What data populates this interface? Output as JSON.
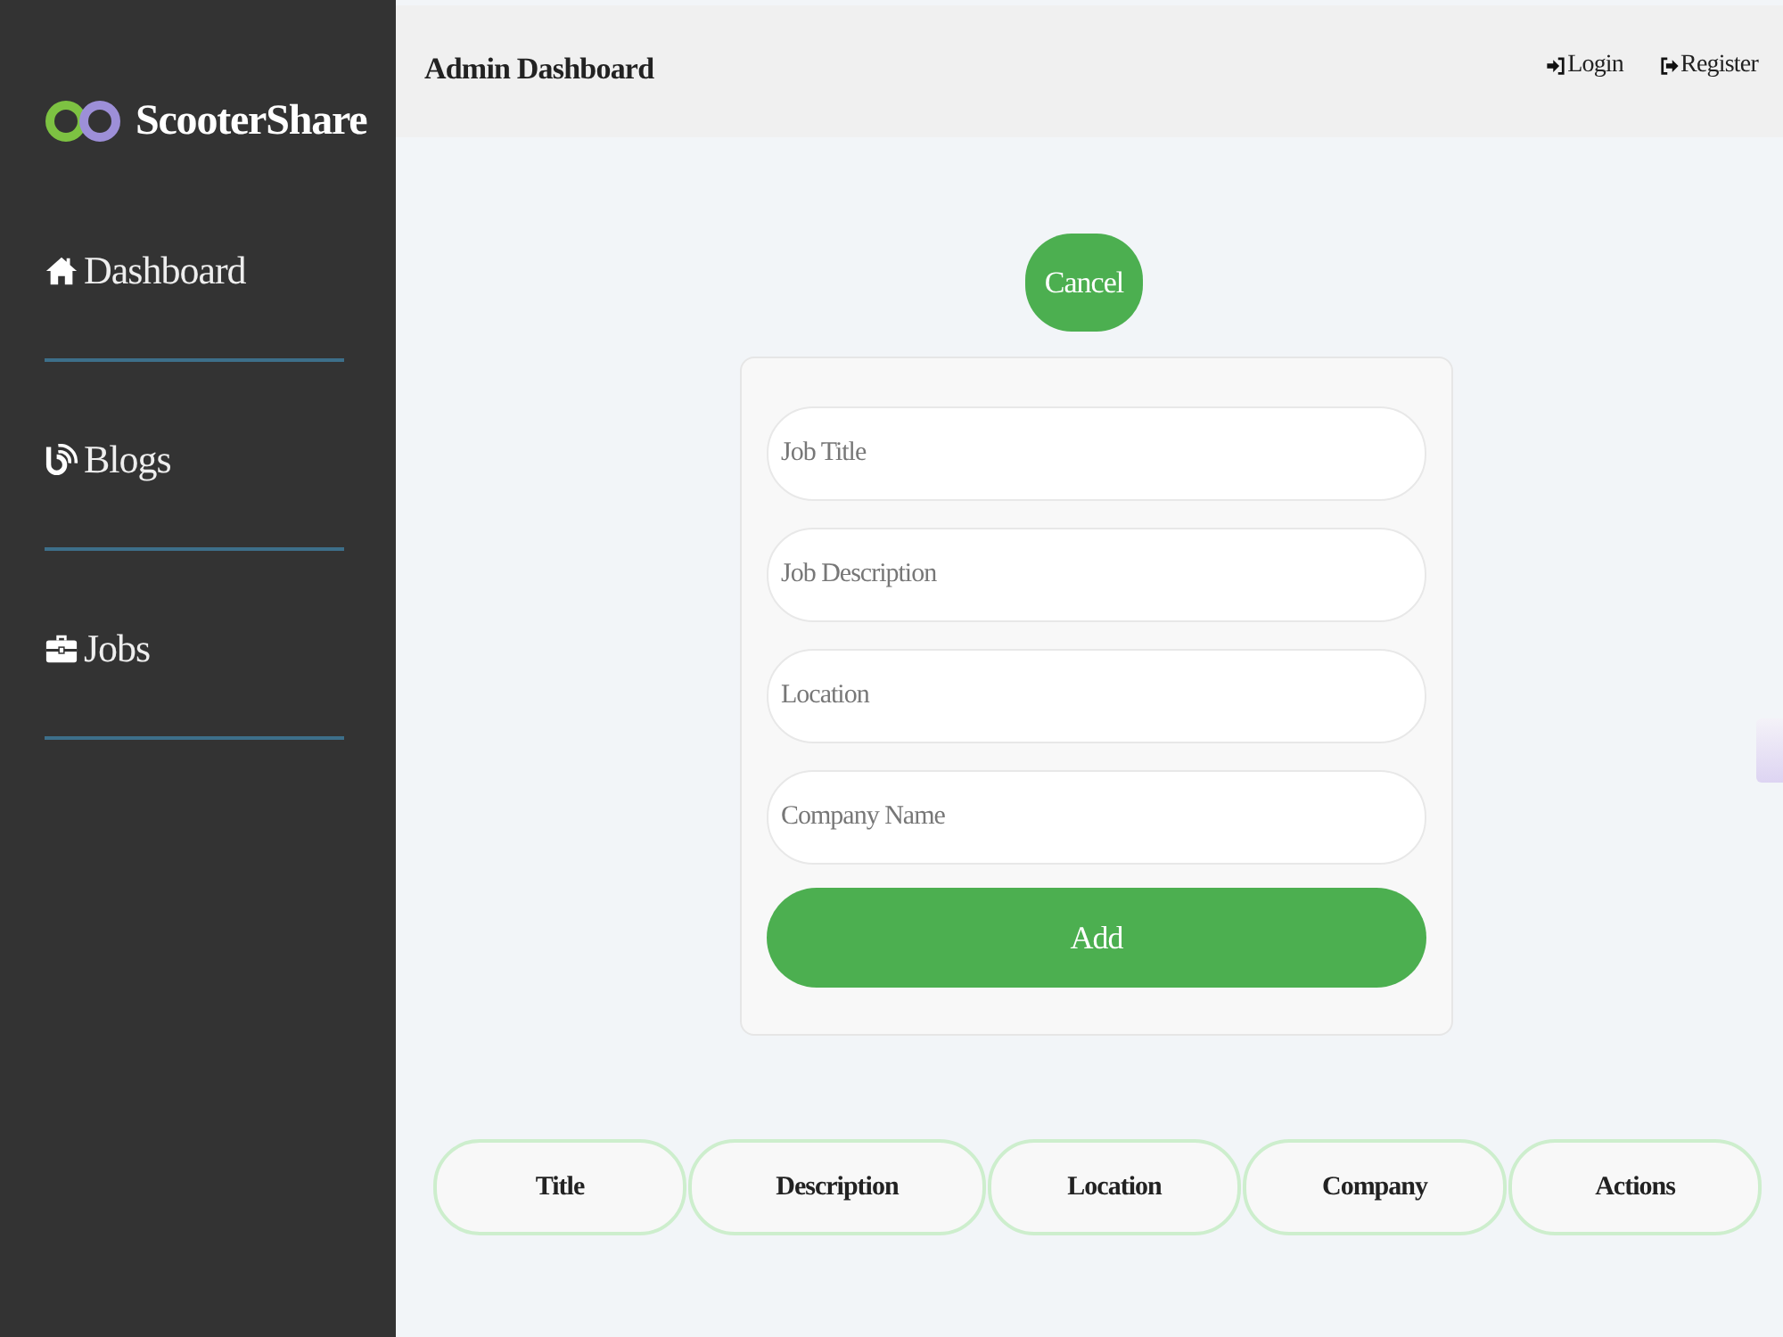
{
  "sidebar": {
    "logo": "ScooterShare",
    "items": [
      {
        "label": "Dashboard"
      },
      {
        "label": "Blogs"
      },
      {
        "label": "Jobs"
      }
    ]
  },
  "header": {
    "title": "Admin Dashboard",
    "links": [
      {
        "label": "Login"
      },
      {
        "label": "Register"
      }
    ]
  },
  "cancel_button": "Cancel",
  "form": {
    "fields": [
      {
        "placeholder": "Job Title"
      },
      {
        "placeholder": "Job Description"
      },
      {
        "placeholder": "Location"
      },
      {
        "placeholder": "Company Name"
      }
    ],
    "submit": "Add"
  },
  "table": {
    "columns": [
      "Title",
      "Description",
      "Location",
      "Company",
      "Actions"
    ]
  }
}
